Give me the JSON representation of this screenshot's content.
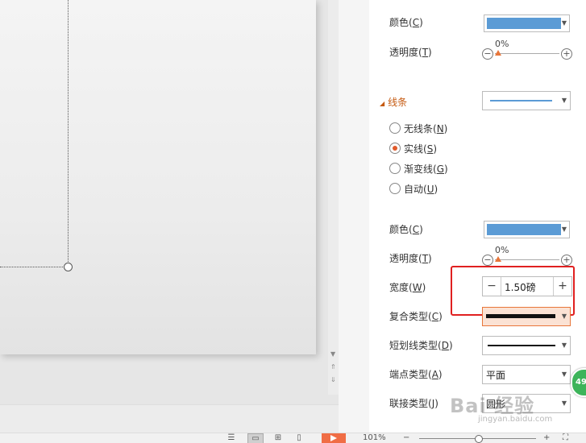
{
  "fill": {
    "color_label": "颜色(",
    "color_key": "C",
    "color_tail": ")",
    "color_value": "#5b9bd5",
    "transparency_label": "透明度(",
    "transparency_key": "T",
    "transparency_tail": ")",
    "transparency_value": "0%"
  },
  "line": {
    "section_title": "线条",
    "options": [
      {
        "label": "无线条(",
        "key": "N",
        "tail": ")",
        "selected": false
      },
      {
        "label": "实线(",
        "key": "S",
        "tail": ")",
        "selected": true
      },
      {
        "label": "渐变线(",
        "key": "G",
        "tail": ")",
        "selected": false
      },
      {
        "label": "自动(",
        "key": "U",
        "tail": ")",
        "selected": false
      }
    ],
    "color_label": "颜色(",
    "color_key": "C",
    "color_tail": ")",
    "color_value": "#5b9bd5",
    "transparency_label": "透明度(",
    "transparency_key": "T",
    "transparency_tail": ")",
    "transparency_value": "0%",
    "width_label": "宽度(",
    "width_key": "W",
    "width_tail": ")",
    "width_value": "1.50磅",
    "compound_label": "复合类型(",
    "compound_key": "C",
    "compound_tail": ")",
    "dash_label": "短划线类型(",
    "dash_key": "D",
    "dash_tail": ")",
    "cap_label": "端点类型(",
    "cap_key": "A",
    "cap_tail": ")",
    "cap_value": "平面",
    "join_label": "联接类型(",
    "join_key": "J",
    "join_tail": ")",
    "join_value": "圆形"
  },
  "badge": {
    "count": "49"
  },
  "watermark": {
    "text": "Bai 经验",
    "sub": "jingyan.baidu.com"
  },
  "statusbar": {
    "zoom": "101%",
    "zoom_minus": "−",
    "zoom_plus": "+"
  }
}
